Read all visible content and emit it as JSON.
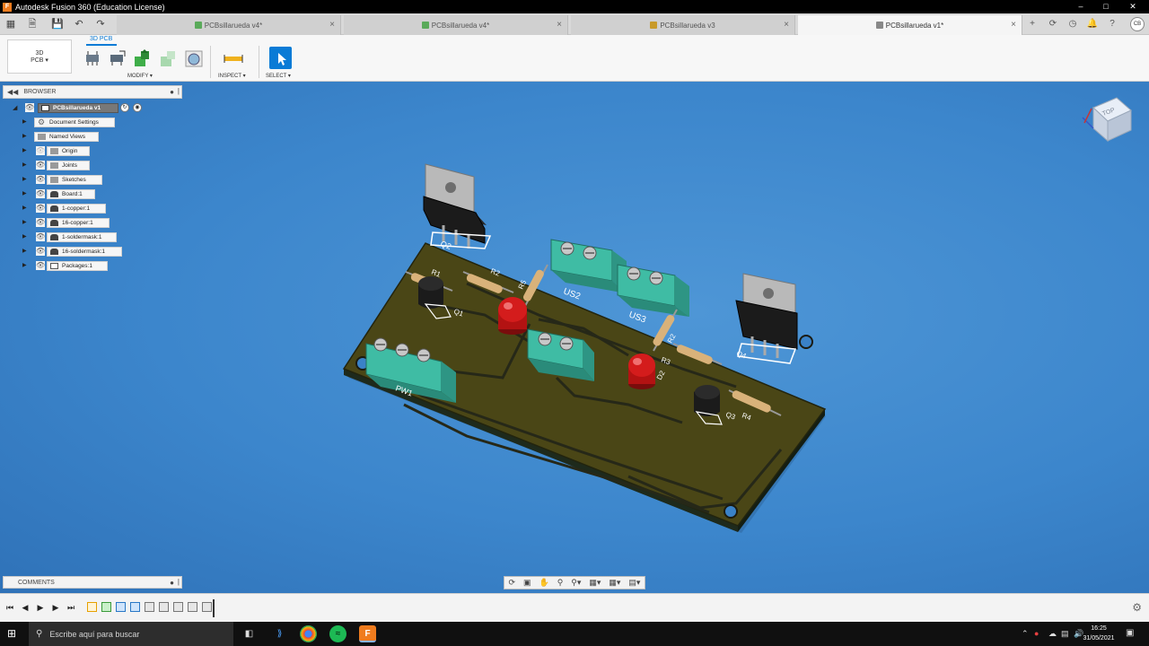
{
  "window": {
    "title": "Autodesk Fusion 360 (Education License)",
    "app_icon": "fusion-f-icon",
    "controls": [
      "minimize-icon",
      "maximize-icon",
      "close-icon"
    ]
  },
  "tabs": [
    {
      "label": "PCBsillarueda v4*",
      "icon": "pcb-doc-icon",
      "active": false
    },
    {
      "label": "PCBsillarueda v4*",
      "icon": "pcb-doc-icon",
      "active": false
    },
    {
      "label": "PCBsillarueda v3",
      "icon": "pcb-doc-icon",
      "active": false
    },
    {
      "label": "PCBsillarueda v1*",
      "icon": "3d-pcb-doc-icon",
      "active": true
    }
  ],
  "user": {
    "initials": "CB"
  },
  "toolbar": {
    "workspace": {
      "line1": "3D",
      "line2": "PCB"
    },
    "workspace_tab": "3D PCB",
    "groups": {
      "modify": "MODIFY",
      "inspect": "INSPECT",
      "select": "SELECT"
    },
    "accent_color": "#0a7bd6"
  },
  "browser": {
    "title": "BROWSER",
    "root": "PCBsillarueda v1",
    "items": [
      {
        "label": "Document Settings",
        "icon": "gear-icon",
        "has_eye": false
      },
      {
        "label": "Named Views",
        "icon": "folder-icon",
        "has_eye": false
      },
      {
        "label": "Origin",
        "icon": "folder-icon",
        "has_eye": true,
        "eye_faded": true
      },
      {
        "label": "Joints",
        "icon": "folder-icon",
        "has_eye": true,
        "eye_faded": false
      },
      {
        "label": "Sketches",
        "icon": "folder-icon",
        "has_eye": true,
        "eye_faded": false
      },
      {
        "label": "Board:1",
        "icon": "component-icon",
        "has_eye": true,
        "eye_faded": false
      },
      {
        "label": "1-copper:1",
        "icon": "component-icon",
        "has_eye": true,
        "eye_faded": false
      },
      {
        "label": "16-copper:1",
        "icon": "component-icon",
        "has_eye": true,
        "eye_faded": false
      },
      {
        "label": "1-soldermask:1",
        "icon": "component-icon",
        "has_eye": true,
        "eye_faded": false
      },
      {
        "label": "16-soldermask:1",
        "icon": "component-icon",
        "has_eye": true,
        "eye_faded": false
      },
      {
        "label": "Packages:1",
        "icon": "package-icon",
        "has_eye": true,
        "eye_faded": false
      }
    ]
  },
  "comments": {
    "title": "COMMENTS"
  },
  "viewcube": {
    "face": "TOP"
  },
  "pcb_labels": {
    "q2": "Q2",
    "r1": "R1",
    "r2": "R2",
    "r5": "R5",
    "q1": "Q1",
    "us2": "US2",
    "us3": "US3",
    "r2b": "R2",
    "r3": "R3",
    "q4": "Q4",
    "d2": "D2",
    "q3": "Q3",
    "r4": "R4",
    "pw1": "PW1"
  },
  "taskbar": {
    "search_placeholder": "Escribe aquí para buscar",
    "time": "16:25",
    "date": "31/05/2021"
  }
}
